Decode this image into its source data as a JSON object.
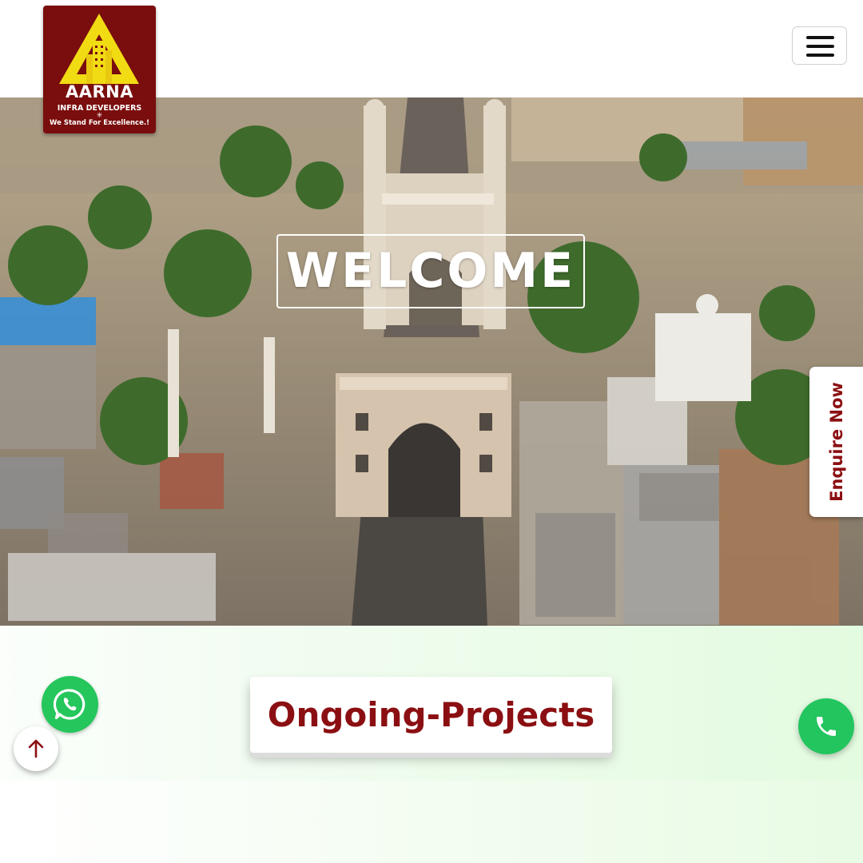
{
  "brand": {
    "name": "AARNA",
    "subtitle": "INFRA DEVELOPERS",
    "tagline": "We Stand For Excellence.!",
    "colors": {
      "maroon": "#7a0d0d",
      "yellow": "#f1dc13",
      "accent_text": "#8b0f12"
    }
  },
  "header": {
    "menu_icon": "hamburger-icon"
  },
  "hero": {
    "welcome_text": "WELCOME",
    "enquire_label": "Enquire Now"
  },
  "section": {
    "heading": "Ongoing-Projects"
  },
  "floating": {
    "whatsapp_icon": "whatsapp-icon",
    "scroll_top_icon": "arrow-up-icon",
    "call_icon": "phone-icon",
    "whatsapp_color": "#25c65c",
    "call_color": "#22c55e"
  }
}
